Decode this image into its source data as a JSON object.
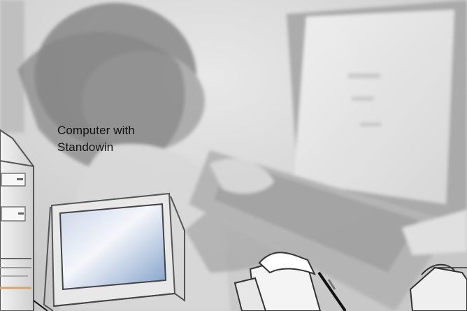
{
  "caption": {
    "line1": "Computer with",
    "line2": "Standowin"
  },
  "icons": {
    "background": "person-at-computer-photo",
    "tower": "desktop-tower-icon",
    "monitor": "crt-monitor-icon",
    "fax": "fax-machine-icon",
    "printer": "printer-icon"
  },
  "colors": {
    "photo_tone": "#d2d2d2",
    "line_art": "#555555",
    "screen_blue": "#9fb8d8",
    "text": "#111111"
  }
}
